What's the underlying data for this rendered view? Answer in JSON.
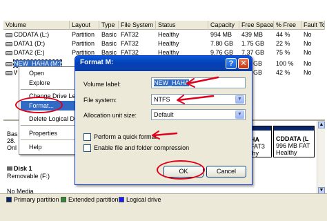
{
  "volume_list": {
    "columns": [
      "Volume",
      "Layout",
      "Type",
      "File System",
      "Status",
      "Capacity",
      "Free Space",
      "% Free",
      "Fault To"
    ],
    "rows": [
      {
        "volume": "CDDATA (L:)",
        "layout": "Partition",
        "type": "Basic",
        "fs": "FAT32",
        "status": "Healthy",
        "capacity": "994 MB",
        "free": "439 MB",
        "pct": "44 %",
        "fault": "No"
      },
      {
        "volume": "DATA1 (D:)",
        "layout": "Partition",
        "type": "Basic",
        "fs": "FAT32",
        "status": "Healthy",
        "capacity": "7.80 GB",
        "free": "1.75 GB",
        "pct": "22 %",
        "fault": "No"
      },
      {
        "volume": "DATA2 (E:)",
        "layout": "Partition",
        "type": "Basic",
        "fs": "FAT32",
        "status": "Healthy",
        "capacity": "9.76 GB",
        "free": "7.37 GB",
        "pct": "75 %",
        "fault": "No"
      },
      {
        "volume": "NEW_HAHA (M:)",
        "layout": "",
        "type": "",
        "fs": "",
        "status": "",
        "capacity": "",
        "free": "GB",
        "pct": "100 %",
        "fault": "No"
      },
      {
        "volume": "W",
        "layout": "",
        "type": "",
        "fs": "",
        "status": "",
        "capacity": "",
        "free": "GB",
        "pct": "42 %",
        "fault": "No"
      }
    ]
  },
  "context_menu": {
    "items": [
      "Open",
      "Explore",
      "Change Drive Let",
      "Format...",
      "Delete Logical Driv",
      "Properties",
      "Help"
    ]
  },
  "graph": {
    "disk0_partial": [
      "Bas",
      "28.",
      "Onl"
    ],
    "part_a": [
      "HA",
      "FAT3",
      "thy"
    ],
    "part_cddata": {
      "name": "CDDATA (L",
      "size": "996 MB FAT",
      "status": "Healthy"
    },
    "disk1": {
      "name": "Disk 1",
      "type": "Removable (F:)",
      "media": "No Media"
    }
  },
  "legend": {
    "primary": "Primary partition",
    "extended": "Extended partition",
    "logical": "Logical drive",
    "colors": {
      "primary": "#0a246a",
      "extended": "#2e8b2e",
      "logical": "#1a1aff"
    }
  },
  "dialog": {
    "title": "Format M:",
    "help_glyph": "?",
    "close_glyph": "✕",
    "volume_label_label": "Volume label:",
    "volume_label_value": "NEW_HAHA",
    "file_system_label": "File system:",
    "file_system_value": "NTFS",
    "alloc_label": "Allocation unit size:",
    "alloc_value": "Default",
    "quick_format_label": "Perform a quick format",
    "compression_label": "Enable file and folder compression",
    "ok_label": "OK",
    "cancel_label": "Cancel"
  }
}
